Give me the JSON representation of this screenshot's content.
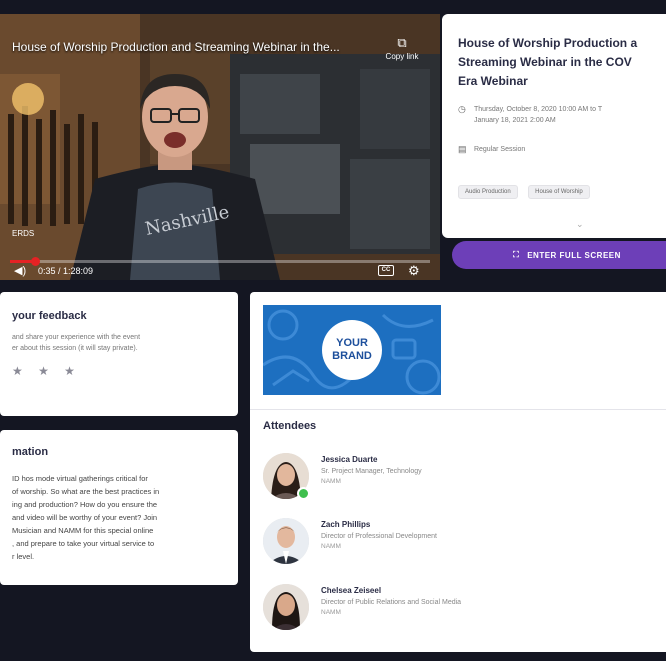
{
  "video": {
    "title": "House of Worship Production and Streaming Webinar in the...",
    "copy_link_label": "Copy link",
    "mini_label": "ERDS",
    "time_readout": "0:35 / 1:28:09",
    "progress": 0.06
  },
  "session": {
    "title_lines": [
      "House of Worship Production a",
      "Streaming Webinar in the COV",
      "Era Webinar"
    ],
    "date_line_1": "Thursday, October 8, 2020 10:00 AM to T",
    "date_line_2": "January 18, 2021 2:00 AM",
    "session_type": "Regular Session",
    "tags": [
      "Audio Production",
      "House of Worship"
    ],
    "fullscreen_label": "ENTER FULL SCREEN"
  },
  "feedback": {
    "title": "your feedback",
    "desc_line_1": "and share your experience with the event",
    "desc_line_2": "er about this session (it will stay private).",
    "stars": "★ ★ ★"
  },
  "information": {
    "title": "mation",
    "body_lines": [
      "ID hos mode virtual gatherings critical for",
      "of worship. So what are the best practices in",
      "ing and production? How do you ensure the",
      "and video will be worthy of your event? Join",
      "Musician and NAMM for this special online",
      ", and prepare to take your virtual service to",
      "r level."
    ]
  },
  "brand": {
    "line1": "YOUR",
    "line2": "BRAND"
  },
  "attendees": {
    "heading": "Attendees",
    "list": [
      {
        "name": "Jessica Duarte",
        "role": "Sr. Project Manager, Technology",
        "org": "NAMM",
        "online": true
      },
      {
        "name": "Zach Phillips",
        "role": "Director of Professional Development",
        "org": "NAMM",
        "online": false
      },
      {
        "name": "Chelsea Zeiseel",
        "role": "Director of Public Relations and Social Media",
        "org": "NAMM",
        "online": false
      }
    ]
  },
  "colors": {
    "accent": "#6d3fb8",
    "progress": "#e52224",
    "page_bg": "#141622",
    "brand_blue": "#1d6fc0"
  },
  "icons": {
    "copy": "copy-link-icon",
    "volume": "volume-icon",
    "cc": "captions-icon",
    "settings": "gear-icon",
    "calendar": "clock-icon",
    "session": "session-icon",
    "expand": "chevron-down-icon",
    "fullscreen": "fullscreen-icon"
  }
}
